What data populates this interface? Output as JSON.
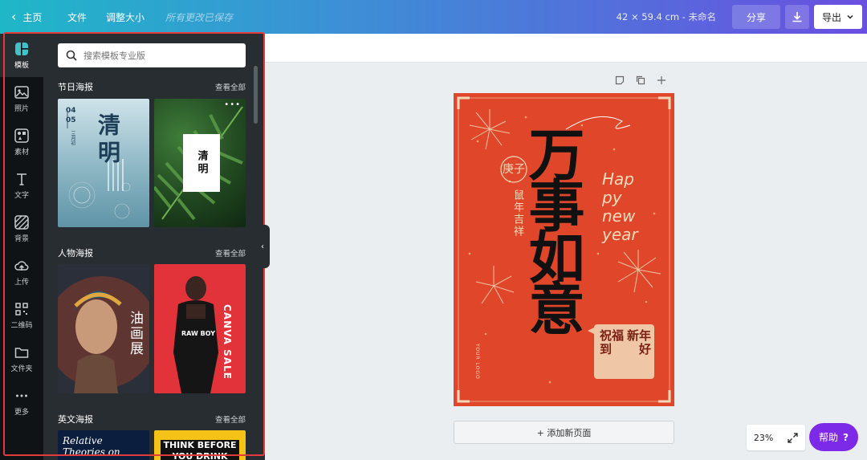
{
  "topbar": {
    "home_label": "主页",
    "file_label": "文件",
    "resize_label": "调整大小",
    "save_status": "所有更改已保存",
    "doc_info": "42 × 59.4 cm - 未命名",
    "share_label": "分享",
    "export_label": "导出"
  },
  "rail": {
    "items": [
      {
        "label": "模板",
        "icon": "template-icon"
      },
      {
        "label": "照片",
        "icon": "photo-icon"
      },
      {
        "label": "素材",
        "icon": "elements-icon"
      },
      {
        "label": "文字",
        "icon": "text-icon"
      },
      {
        "label": "背景",
        "icon": "background-icon"
      },
      {
        "label": "上传",
        "icon": "upload-icon"
      },
      {
        "label": "二维码",
        "icon": "qrcode-icon"
      },
      {
        "label": "文件夹",
        "icon": "folder-icon"
      },
      {
        "label": "更多",
        "icon": "more-icon"
      }
    ]
  },
  "panel": {
    "search_placeholder": "搜索模板专业版",
    "sections": [
      {
        "title": "节日海报",
        "see_all": "查看全部"
      },
      {
        "title": "人物海报",
        "see_all": "查看全部"
      },
      {
        "title": "英文海报",
        "see_all": "查看全部"
      }
    ],
    "thumbs": {
      "qingming1": {
        "date_top": "04",
        "date_bottom": "05",
        "title": "清明",
        "sub": "三月初"
      },
      "qingming2": {
        "title": "清明"
      },
      "oil": {
        "title": "油画展"
      },
      "canva": {
        "title": "CANVA SALE",
        "shirt": "RAW BOY"
      },
      "relative": {
        "line1": "Relative",
        "line2": "Theories on"
      },
      "think": {
        "line1": "THINK BEFORE",
        "line2": "YOU DRINK"
      }
    }
  },
  "canvas": {
    "poster": {
      "year_char": "庚子",
      "subtitle": "鼠年吉祥",
      "main_text": "万事如意",
      "happy_1": "Hap",
      "happy_2": "py",
      "happy_3": "new",
      "happy_4": "year",
      "stamp_1": "新年",
      "stamp_2": "好",
      "stamp_3": "祝福",
      "stamp_4": "到",
      "logo": "YOUR LOGO"
    },
    "add_page_label": "+ 添加新页面",
    "zoom": "23%",
    "help_label": "帮助"
  },
  "colors": {
    "accent": "#7d2ae8",
    "poster_red": "#e0472a",
    "panel_bg": "#272d31",
    "rail_bg": "#0f1315",
    "highlight_outline": "#e23b3b"
  }
}
